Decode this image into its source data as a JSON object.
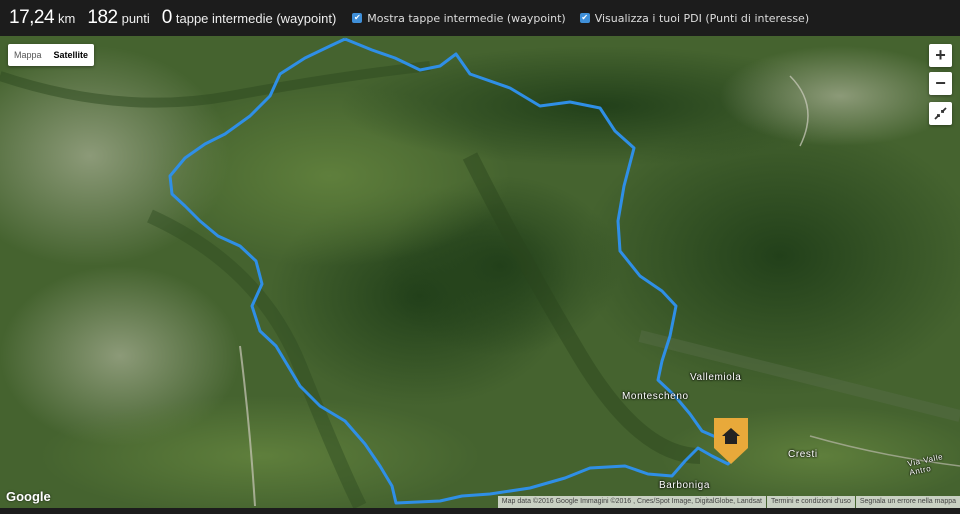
{
  "stats": {
    "distance_value": "17,24",
    "distance_unit": "km",
    "points_value": "182",
    "points_unit": "punti",
    "stops_value": "0",
    "stops_unit": "tappe intermedie (waypoint)"
  },
  "options": {
    "show_waypoints": "Mostra tappe intermedie (waypoint)",
    "show_poi": "Visualizza i tuoi PDI (Punti di interesse)"
  },
  "map": {
    "type_controls": [
      "Mappa",
      "Satellite"
    ],
    "active_type": "Satellite",
    "zoom_in": "+",
    "zoom_out": "−",
    "places": [
      "Vallemiola",
      "Montescheno",
      "Cresti",
      "Barboniga",
      "Via Valle Antro"
    ],
    "logo": "Google",
    "attribution": "Map data ©2016 Google Immagini ©2016 , Cnes/Spot Image, DigitalGlobe, Landsat",
    "terms": "Termini e condizioni d'uso",
    "report": "Segnala un errore nella mappa",
    "route_color": "#2f8fe6",
    "marker_color": "#e8a93a",
    "marker_icon": "home-icon"
  }
}
